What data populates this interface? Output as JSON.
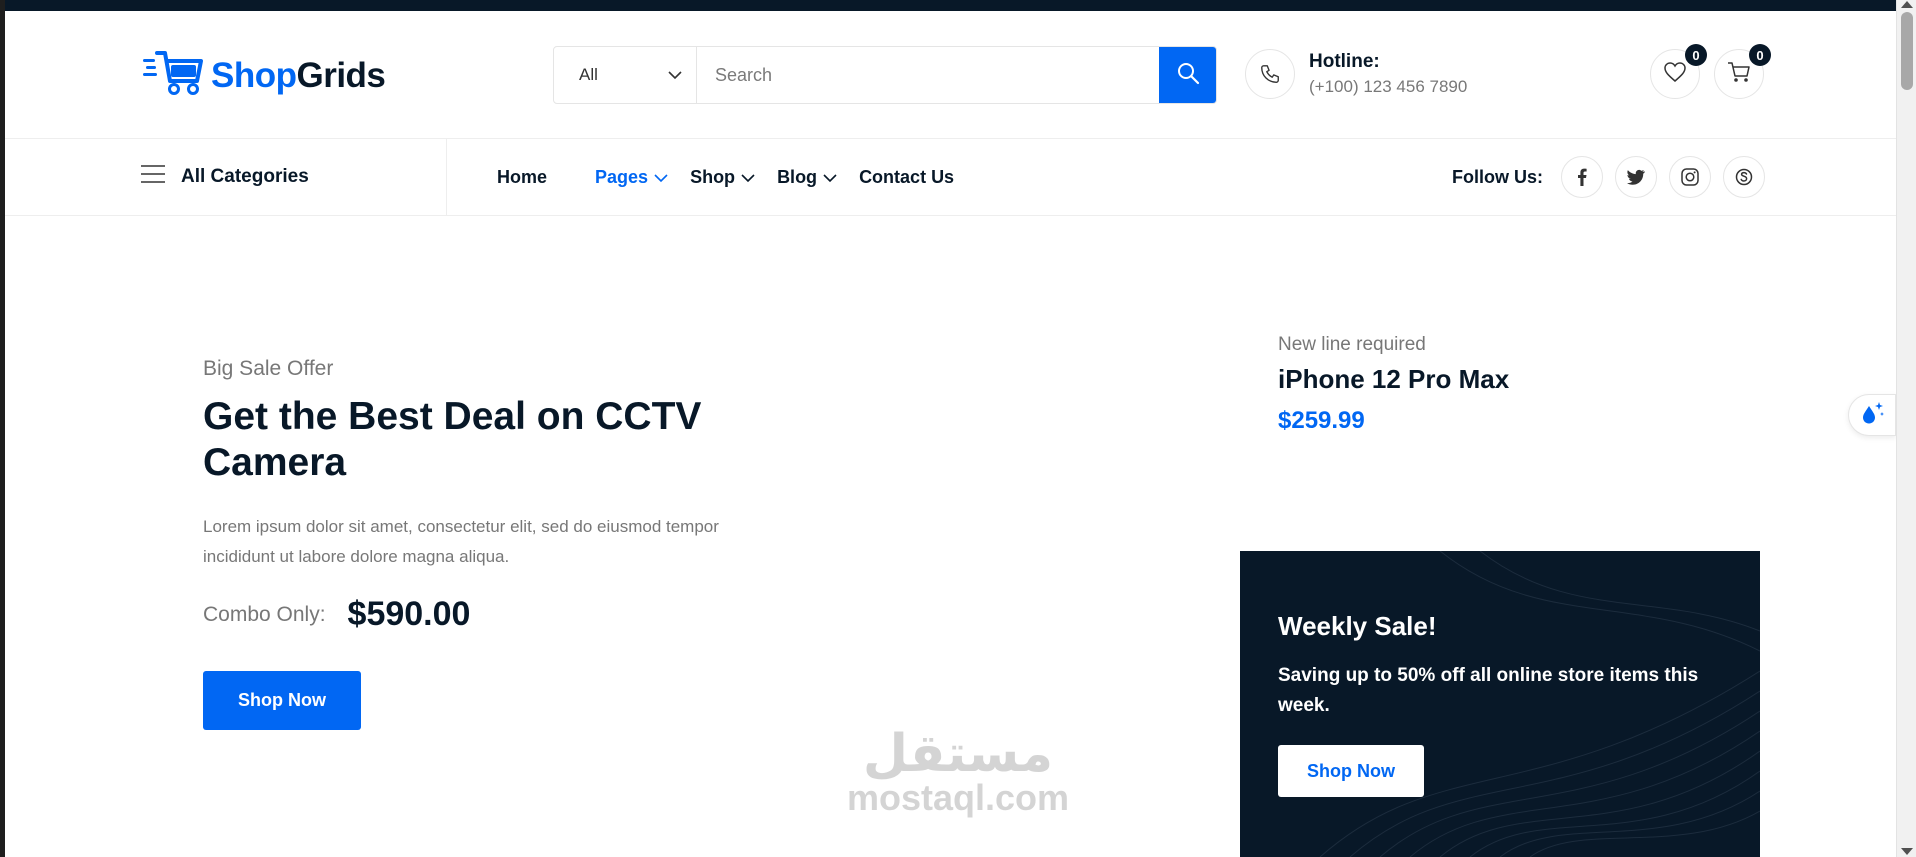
{
  "colors": {
    "primary": "#0167f3",
    "dark": "#081828",
    "muted": "#777777"
  },
  "logo": {
    "part1": "Shop",
    "part2": "Grids"
  },
  "search": {
    "category": "All",
    "placeholder": "Search"
  },
  "hotline": {
    "title": "Hotline:",
    "number": "(+100) 123 456 7890"
  },
  "wishlist": {
    "count": "0"
  },
  "cart": {
    "count": "0"
  },
  "nav": {
    "all_categories": "All Categories",
    "items": [
      {
        "label": "Home"
      },
      {
        "label": "Pages"
      },
      {
        "label": "Shop"
      },
      {
        "label": "Blog"
      },
      {
        "label": "Contact Us"
      }
    ],
    "active": "Pages",
    "follow_label": "Follow Us:",
    "social": [
      "facebook-icon",
      "twitter-icon",
      "instagram-icon",
      "skype-icon"
    ]
  },
  "hero": {
    "subtitle": "Big Sale Offer",
    "title": "Get the Best Deal on CCTV Camera",
    "description": "Lorem ipsum dolor sit amet, consectetur elit, sed do eiusmod tempor incididunt ut labore dolore magna aliqua.",
    "combo_label": "Combo Only:",
    "combo_price": "$590.00",
    "button": "Shop Now"
  },
  "side_product": {
    "tag": "New line required",
    "name": "iPhone 12 Pro Max",
    "price": "$259.99"
  },
  "weekly_sale": {
    "title": "Weekly Sale!",
    "description": "Saving up to 50% off all online store items this week.",
    "button": "Shop Now"
  },
  "watermark": {
    "arabic": "مستقل",
    "latin": "mostaql.com"
  }
}
